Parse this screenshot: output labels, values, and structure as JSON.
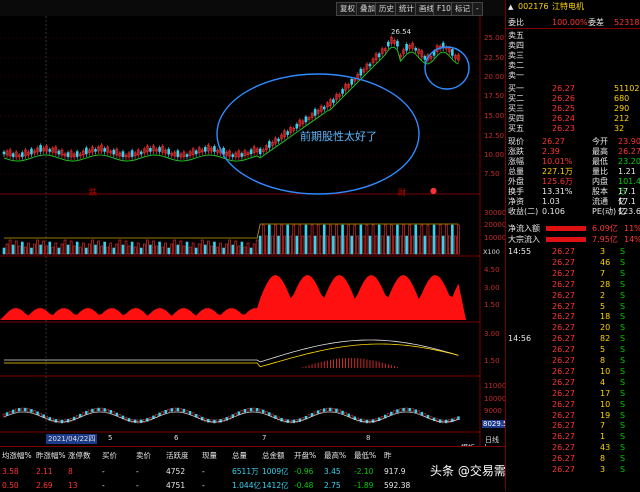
{
  "toolbar": {
    "buttons": [
      "复权",
      "叠加",
      "历史",
      "统计",
      "画线",
      "F10",
      "标记",
      "-"
    ]
  },
  "main_chart": {
    "price_labels": [
      "25.00",
      "22.50",
      "20.00",
      "17.50",
      "15.00",
      "12.50",
      "10.00",
      "7.50"
    ],
    "peak_label": "26.54",
    "annotation": "前期股性太好了",
    "marker_left": "跌",
    "marker_right": "财",
    "red_dot": "●"
  },
  "volume_pane": {
    "labels": [
      "30000",
      "20000",
      "10000"
    ],
    "unit": "X100"
  },
  "pane3": {
    "labels": [
      "4.50",
      "3.00",
      "1.50"
    ]
  },
  "pane4": {
    "labels": [
      "3.00",
      "1.50"
    ]
  },
  "pane5": {
    "labels": [
      "11000",
      "10000",
      "9000",
      "8000"
    ],
    "current": "8029.54"
  },
  "date_axis": {
    "first": "2021/04/22",
    "weekday": "四",
    "month_marks": [
      "5",
      "6",
      "7",
      "8"
    ]
  },
  "nav": {
    "model": "模板",
    "zoom_in": "+",
    "zoom_out": "-",
    "period": "日线"
  },
  "stats": {
    "headers": [
      "均涨幅%",
      "昨涨幅%",
      "涨停数",
      "买价",
      "卖价",
      "活跃度",
      "现量",
      "总量",
      "总金额",
      "开盘%",
      "最高%",
      "最低%",
      "昨"
    ],
    "rows": [
      [
        "3.58",
        "2.11",
        "8",
        "-",
        "-",
        "4752",
        "-",
        "6511万",
        "1009亿",
        "-0.96",
        "3.45",
        "-2.10",
        "917.9"
      ],
      [
        "0.50",
        "2.69",
        "13",
        "-",
        "-",
        "4751",
        "-",
        "1.044亿",
        "1412亿",
        "-0.48",
        "2.75",
        "-1.89",
        "592.38"
      ]
    ]
  },
  "watermark": "头条 @交易需要集大成者",
  "panel": {
    "code": "002176",
    "name": "江特电机",
    "webi_label": "委比",
    "webi": "100.00%",
    "weicha_label": "委差",
    "weicha": "52318",
    "sells": [
      {
        "label": "卖五",
        "price": "",
        "vol": ""
      },
      {
        "label": "卖四",
        "price": "",
        "vol": ""
      },
      {
        "label": "卖三",
        "price": "",
        "vol": ""
      },
      {
        "label": "卖二",
        "price": "",
        "vol": ""
      },
      {
        "label": "卖一",
        "price": "",
        "vol": ""
      }
    ],
    "buys": [
      {
        "label": "买一",
        "price": "26.27",
        "vol": "51102"
      },
      {
        "label": "买二",
        "price": "26.26",
        "vol": "680"
      },
      {
        "label": "买三",
        "price": "26.25",
        "vol": "290"
      },
      {
        "label": "买四",
        "price": "26.24",
        "vol": "212"
      },
      {
        "label": "买五",
        "price": "26.23",
        "vol": "32"
      }
    ],
    "quote": [
      [
        "现价",
        "26.27",
        "今开",
        "23.90"
      ],
      [
        "涨跌",
        "2.39",
        "最高",
        "26.27"
      ],
      [
        "涨幅",
        "10.01%",
        "最低",
        "23.20"
      ],
      [
        "总量",
        "227.1万",
        "量比",
        "1.21"
      ],
      [
        "外盘",
        "125.6万",
        "内盘",
        "101.4万"
      ],
      [
        "换手",
        "13.31%",
        "股本",
        "17.1亿"
      ],
      [
        "净资",
        "1.03",
        "流通",
        "17.1亿"
      ],
      [
        "收益(二)",
        "0.106",
        "PE(动)",
        "123.6"
      ]
    ],
    "flow": [
      {
        "label": "净流入额",
        "value": "6.09亿",
        "pct": "11%"
      },
      {
        "label": "大宗流入",
        "value": "7.95亿",
        "pct": "14%"
      }
    ],
    "ticks": [
      {
        "time": "14:55",
        "price": "26.27",
        "vol": "3",
        "dir": "S"
      },
      {
        "time": "",
        "price": "26.27",
        "vol": "46",
        "dir": "S"
      },
      {
        "time": "",
        "price": "26.27",
        "vol": "7",
        "dir": "S"
      },
      {
        "time": "",
        "price": "26.27",
        "vol": "28",
        "dir": "S"
      },
      {
        "time": "",
        "price": "26.27",
        "vol": "2",
        "dir": "S"
      },
      {
        "time": "",
        "price": "26.27",
        "vol": "5",
        "dir": "S"
      },
      {
        "time": "",
        "price": "26.27",
        "vol": "18",
        "dir": "S"
      },
      {
        "time": "",
        "price": "26.27",
        "vol": "20",
        "dir": "S"
      },
      {
        "time": "14:56",
        "price": "26.27",
        "vol": "82",
        "dir": "S"
      },
      {
        "time": "",
        "price": "26.27",
        "vol": "5",
        "dir": "S"
      },
      {
        "time": "",
        "price": "26.27",
        "vol": "8",
        "dir": "S"
      },
      {
        "time": "",
        "price": "26.27",
        "vol": "10",
        "dir": "S"
      },
      {
        "time": "",
        "price": "26.27",
        "vol": "4",
        "dir": "S"
      },
      {
        "time": "",
        "price": "26.27",
        "vol": "17",
        "dir": "S"
      },
      {
        "time": "",
        "price": "26.27",
        "vol": "10",
        "dir": "S"
      },
      {
        "time": "",
        "price": "26.27",
        "vol": "19",
        "dir": "S"
      },
      {
        "time": "",
        "price": "26.27",
        "vol": "7",
        "dir": "S"
      },
      {
        "time": "",
        "price": "26.27",
        "vol": "1",
        "dir": "S"
      },
      {
        "time": "",
        "price": "26.27",
        "vol": "43",
        "dir": "S"
      },
      {
        "time": "",
        "price": "26.27",
        "vol": "8",
        "dir": "S"
      },
      {
        "time": "",
        "price": "26.27",
        "vol": "3",
        "dir": "S"
      }
    ]
  }
}
